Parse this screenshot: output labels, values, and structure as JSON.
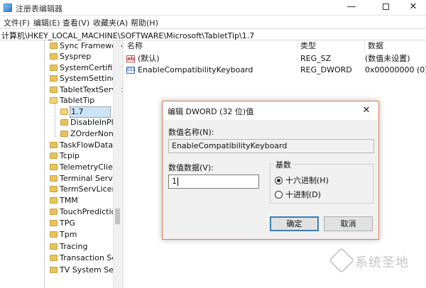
{
  "window": {
    "title": "注册表编辑器",
    "min_glyph": "—",
    "close_glyph": "✕"
  },
  "menu": [
    "文件(F)",
    "编辑(E)",
    "查看(V)",
    "收藏夹(A)",
    "帮助(H)"
  ],
  "address": "计算机\\HKEY_LOCAL_MACHINE\\SOFTWARE\\Microsoft\\TabletTip\\1.7",
  "tree": {
    "items": [
      {
        "label": "Sync Framework"
      },
      {
        "label": "Sysprep"
      },
      {
        "label": "SystemCertificat"
      },
      {
        "label": "SystemSettings"
      },
      {
        "label": "TabletTextServic"
      },
      {
        "label": "TabletTip"
      },
      {
        "label": "1.7"
      },
      {
        "label": "DisableInPla"
      },
      {
        "label": "ZOrderNonC"
      },
      {
        "label": "TaskFlowDataEr"
      },
      {
        "label": "Tcpip"
      },
      {
        "label": "TelemetryClient"
      },
      {
        "label": "Terminal Server"
      },
      {
        "label": "TermServLicens"
      },
      {
        "label": "TMM"
      },
      {
        "label": "TouchPrediction"
      },
      {
        "label": "TPG"
      },
      {
        "label": "Tpm"
      },
      {
        "label": "Tracing"
      },
      {
        "label": "Transaction Ser"
      },
      {
        "label": "TV System Serv"
      }
    ]
  },
  "values": {
    "headers": {
      "name": "名称",
      "type": "类型",
      "data": "数据"
    },
    "rows": [
      {
        "icon": "string-value-icon",
        "icon_text": "ab",
        "name": "(默认)",
        "type": "REG_SZ",
        "data": "(数值未设置)"
      },
      {
        "icon": "binary-value-icon",
        "icon_text": "011",
        "name": "EnableCompatibilityKeyboard",
        "type": "REG_DWORD",
        "data": "0x00000000 (0)"
      }
    ]
  },
  "dialog": {
    "title": "编辑 DWORD (32 位)值",
    "close_glyph": "✕",
    "value_name_label": "数值名称(N):",
    "value_name": "EnableCompatibilityKeyboard",
    "value_data_label": "数值数据(V):",
    "value_data": "1",
    "base_label": "基数",
    "base_options": [
      {
        "label": "十六进制(H)",
        "selected": true
      },
      {
        "label": "十进制(D)",
        "selected": false
      }
    ],
    "ok_label": "确定",
    "cancel_label": "取消"
  },
  "watermark": {
    "text": "系统圣地"
  },
  "colors": {
    "selection": "#cce4f7",
    "dialog_border": "#e07b5a",
    "default_button_border": "#3c7fb1",
    "folder": "#e8c25c"
  }
}
